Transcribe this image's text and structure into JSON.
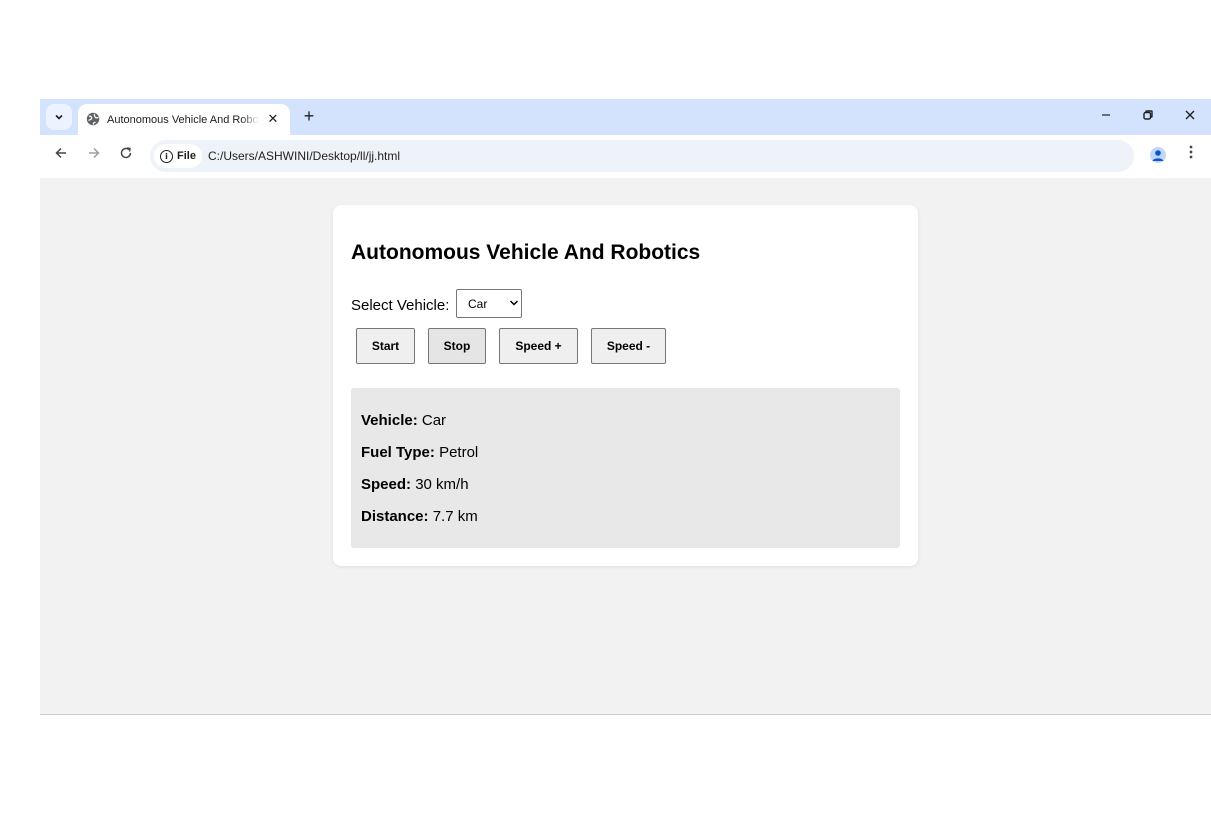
{
  "browser": {
    "tab_title": "Autonomous Vehicle And Robotics",
    "tab_close": "✕",
    "new_tab": "+",
    "site_label": "File",
    "url": "C:/Users/ASHWINI/Desktop/ll/jj.html",
    "icons": [
      "tab-search-icon",
      "globe-icon",
      "close-icon",
      "plus-icon",
      "minimize-icon",
      "restore-icon",
      "back-icon",
      "forward-icon",
      "reload-icon",
      "info-icon",
      "star-icon",
      "profile-icon",
      "kebab-menu-icon"
    ]
  },
  "page": {
    "title": "Autonomous Vehicle And Robotics",
    "select_label": "Select Vehicle:",
    "selected_vehicle": "Car",
    "buttons": {
      "start": "Start",
      "stop": "Stop",
      "speed_up": "Speed +",
      "speed_down": "Speed -"
    },
    "info": {
      "vehicle_label": "Vehicle:",
      "vehicle_value": "Car",
      "fuel_label": "Fuel Type:",
      "fuel_value": "Petrol",
      "speed_label": "Speed:",
      "speed_value": "30 km/h",
      "distance_label": "Distance:",
      "distance_value": "7.7 km"
    }
  },
  "colors": {
    "tabstrip": "#d3e3fd",
    "page_background": "#f2f2f2",
    "card": "#ffffff",
    "info_box": "#e8e8e8"
  }
}
